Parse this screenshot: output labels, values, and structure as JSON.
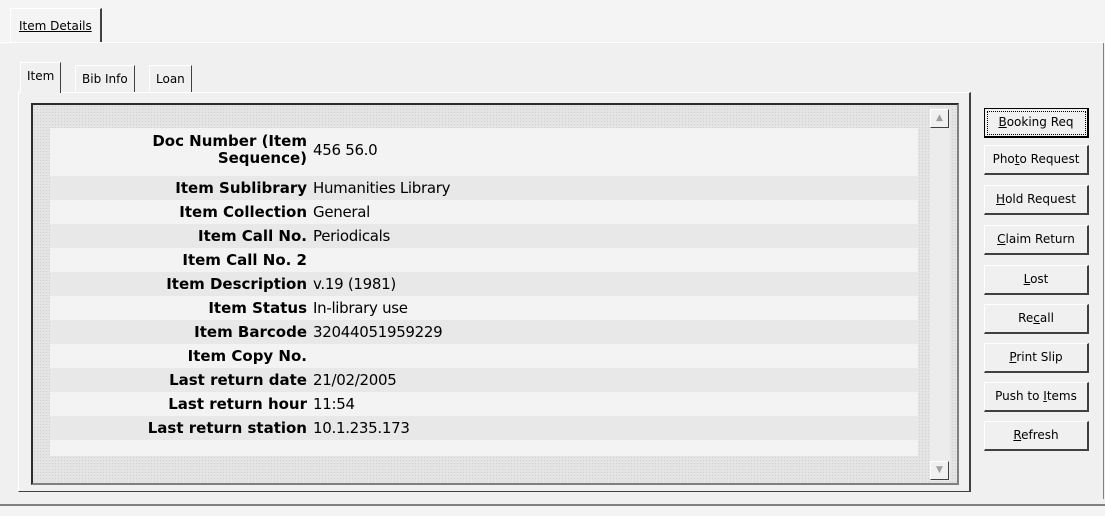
{
  "outer_tab": {
    "label": "Item Details"
  },
  "inner_tabs": [
    {
      "label": "Item"
    },
    {
      "label": "Bib Info"
    },
    {
      "label": "Loan"
    }
  ],
  "fields": [
    {
      "label": "Doc Number (Item Sequence)",
      "value": "456 56.0"
    },
    {
      "label": "Item Sublibrary",
      "value": "Humanities Library"
    },
    {
      "label": "Item Collection",
      "value": "General"
    },
    {
      "label": "Item Call No.",
      "value": "Periodicals"
    },
    {
      "label": "Item Call No. 2",
      "value": ""
    },
    {
      "label": "Item Description",
      "value": "v.19 (1981)"
    },
    {
      "label": "Item Status",
      "value": "In-library use"
    },
    {
      "label": "Item Barcode",
      "value": "32044051959229"
    },
    {
      "label": "Item Copy No.",
      "value": ""
    },
    {
      "label": "Last return date",
      "value": "21/02/2005"
    },
    {
      "label": "Last return hour",
      "value": "11:54"
    },
    {
      "label": "Last return station",
      "value": "10.1.235.173"
    }
  ],
  "buttons": [
    {
      "pre": "",
      "key": "B",
      "post": "ooking Req",
      "focused": true
    },
    {
      "pre": "Pho",
      "key": "t",
      "post": "o Request"
    },
    {
      "pre": "",
      "key": "H",
      "post": "old Request"
    },
    {
      "pre": "",
      "key": "C",
      "post": "laim Return"
    },
    {
      "pre": "",
      "key": "L",
      "post": "ost"
    },
    {
      "pre": "Re",
      "key": "c",
      "post": "all"
    },
    {
      "pre": "",
      "key": "P",
      "post": "rint Slip"
    },
    {
      "pre": "Push to ",
      "key": "I",
      "post": "tems"
    },
    {
      "pre": "",
      "key": "R",
      "post": "efresh"
    }
  ],
  "scrollbar": {
    "up_icon": "triangle-up",
    "down_icon": "triangle-down"
  }
}
